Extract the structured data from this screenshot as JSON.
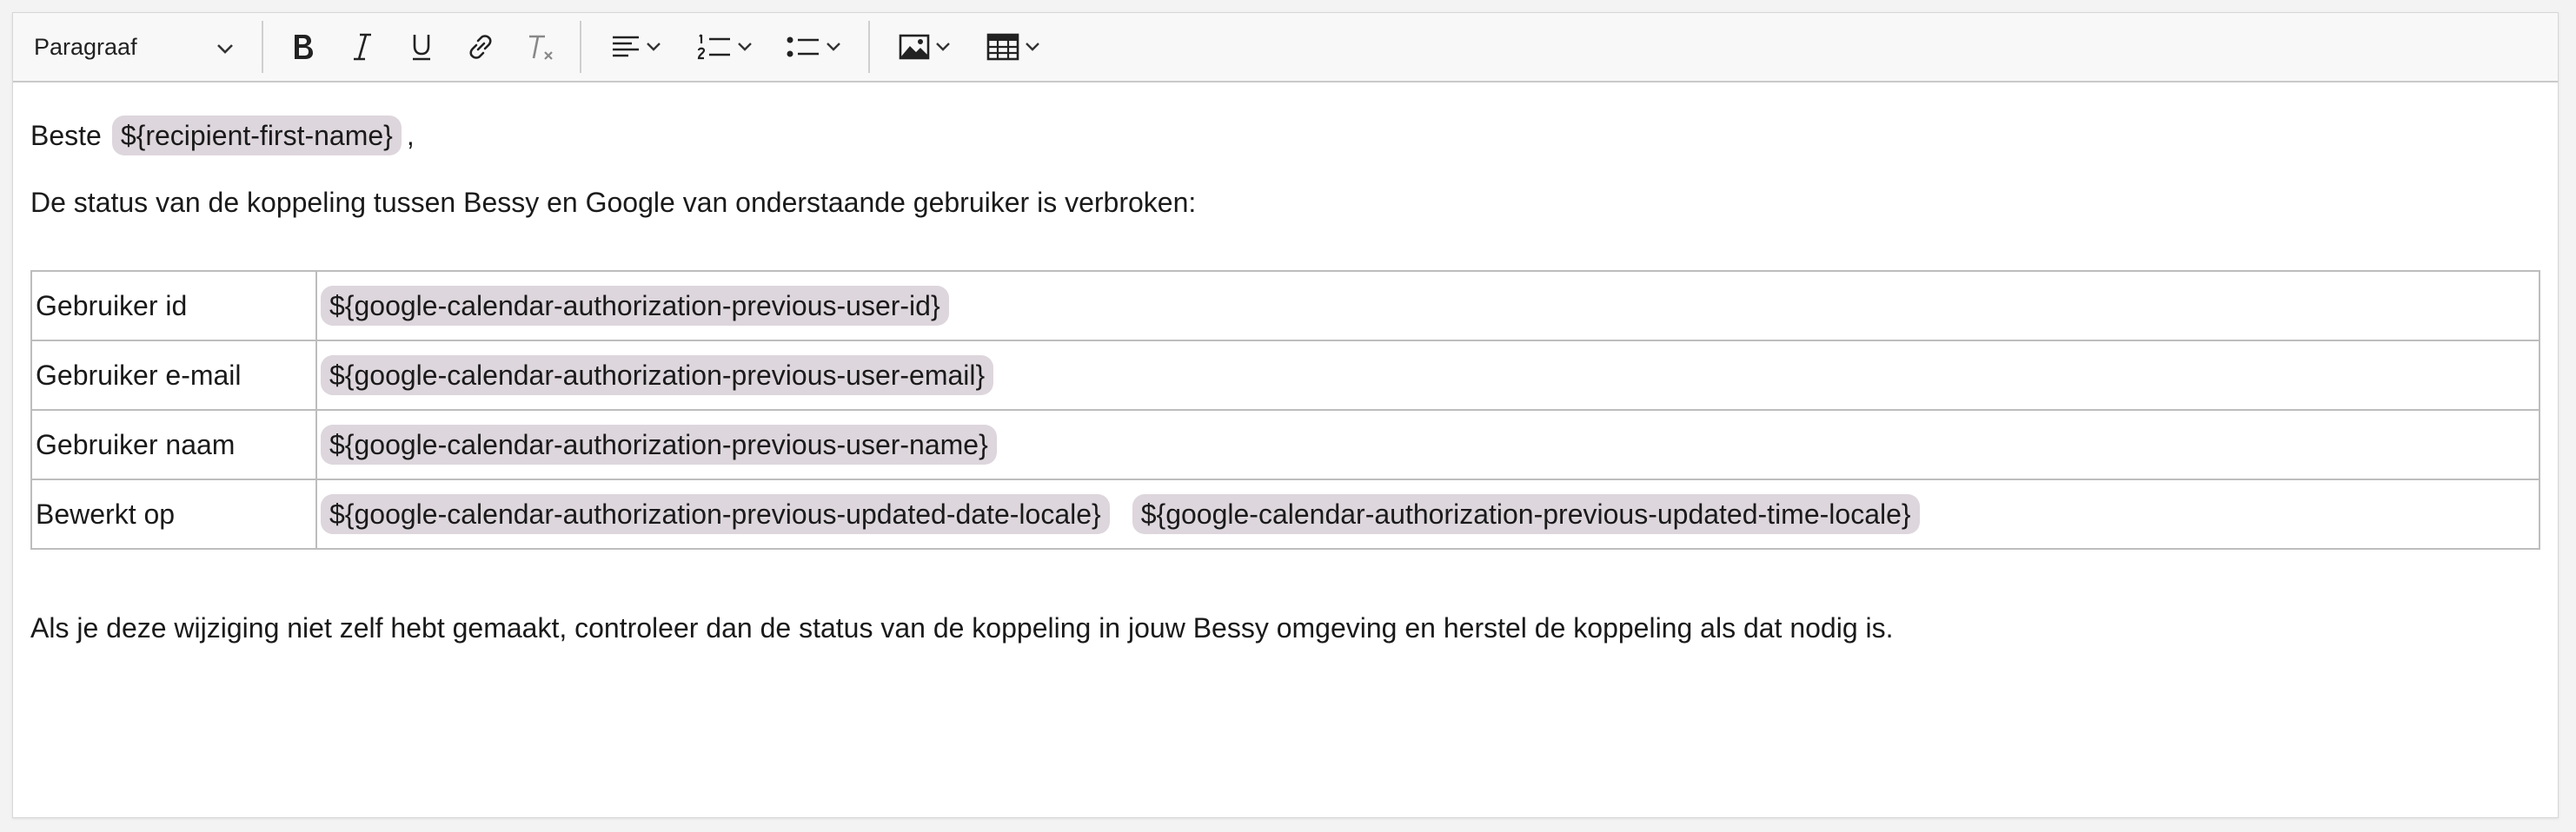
{
  "toolbar": {
    "heading_select": "Paragraaf",
    "icons": [
      "bold-icon",
      "italic-icon",
      "underline-icon",
      "link-icon",
      "remove-format-icon",
      "align-icon",
      "numbered-list-icon",
      "bulleted-list-icon",
      "image-icon",
      "table-icon"
    ]
  },
  "body": {
    "greeting": "Beste",
    "recipient_placeholder": "${recipient-first-name}",
    "greeting_comma": ",",
    "intro": "De status van de koppeling tussen Bessy en Google van onderstaande gebruiker is verbroken:",
    "table": [
      {
        "label": "Gebruiker id",
        "values": [
          "${google-calendar-authorization-previous-user-id}"
        ]
      },
      {
        "label": "Gebruiker e-mail",
        "values": [
          "${google-calendar-authorization-previous-user-email}"
        ]
      },
      {
        "label": "Gebruiker naam",
        "values": [
          "${google-calendar-authorization-previous-user-name}"
        ]
      },
      {
        "label": "Bewerkt op",
        "values": [
          "${google-calendar-authorization-previous-updated-date-locale}",
          "${google-calendar-authorization-previous-updated-time-locale}"
        ]
      }
    ],
    "closing": "Als je deze wijziging niet zelf hebt gemaakt, controleer dan de status van de koppeling in jouw Bessy omgeving en herstel de koppeling als dat nodig is."
  },
  "colors": {
    "placeholder_bg": "#ddd6dc",
    "toolbar_bg": "#f8f8f8",
    "table_border": "#bdbdbd"
  }
}
